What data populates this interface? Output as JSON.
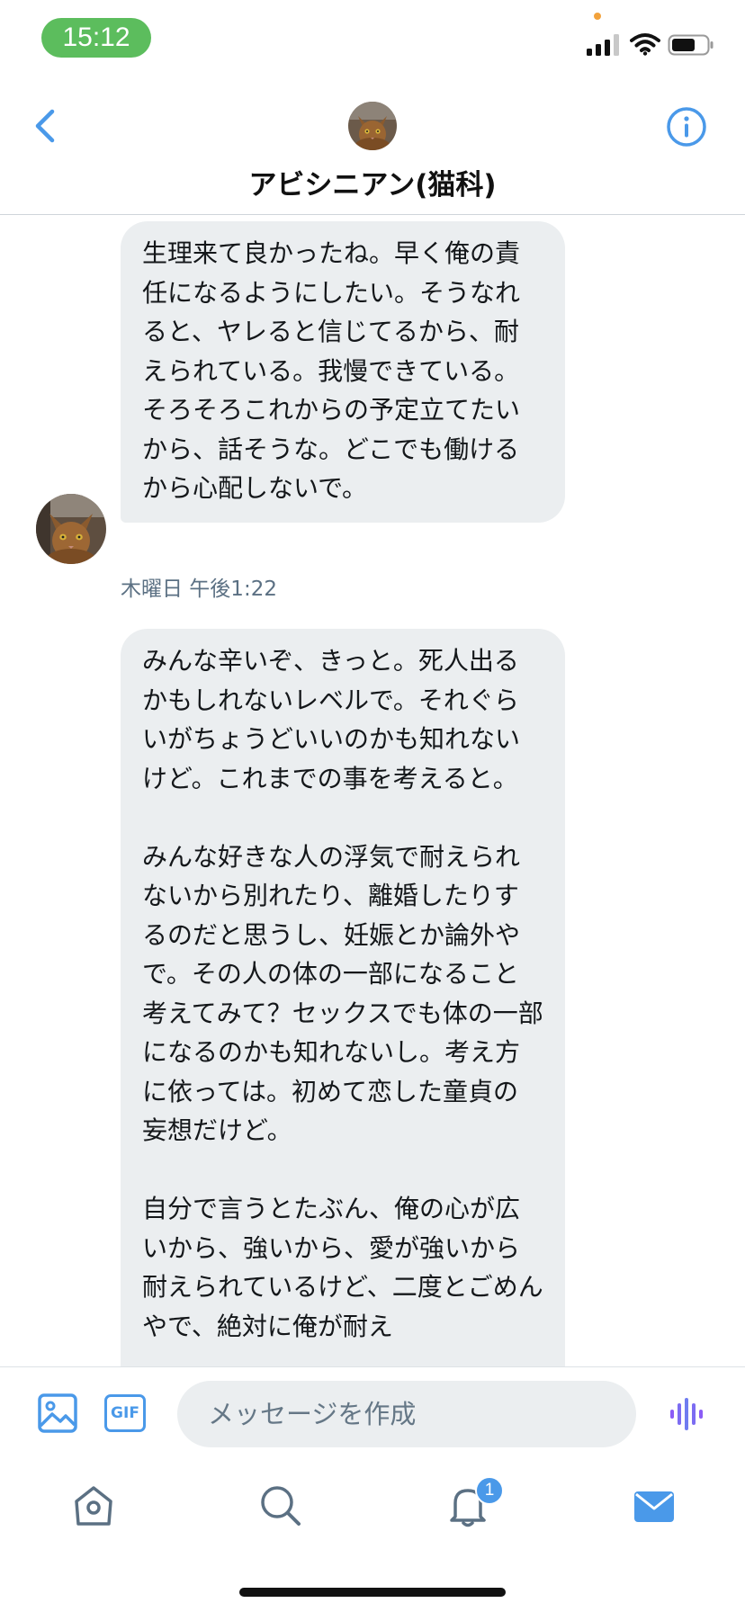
{
  "status_bar": {
    "time": "15:12"
  },
  "header": {
    "title": "アビシニアン(猫科)",
    "back_icon": "chevron-left-icon",
    "info_icon": "info-icon"
  },
  "messages": [
    {
      "text": "生理来て良かったね。早く俺の責任になるようにしたい。そうなれると、ヤレると信じてるから、耐えられている。我慢できている。\nそろそろこれからの予定立てたいから、話そうな。どこでも働けるから心配しないで。",
      "timestamp": "木曜日 午後1:22"
    },
    {
      "text": "みんな辛いぞ、きっと。死人出るかもしれないレベルで。それぐらいがちょうどいいのかも知れないけど。これまでの事を考えると。\n\nみんな好きな人の浮気で耐えられないから別れたり、離婚したりするのだと思うし、妊娠とか論外やで。その人の体の一部になること考えてみて？セックスでも体の一部になるのかも知れないし。考え方に依っては。初めて恋した童貞の妄想だけど。\n\n自分で言うとたぶん、俺の心が広いから、強いから、愛が強いから耐えられているけど、二度とごめんやで、絶対に俺が耐え"
    }
  ],
  "composer": {
    "placeholder": "メッセージを作成",
    "gif_label": "GIF"
  },
  "tab_bar": {
    "notifications_badge": "1"
  },
  "colors": {
    "accent": "#4a99e9",
    "bubble": "#ebeef0",
    "status_pill": "#5cbd5d",
    "voice": "#8b5cf6"
  }
}
